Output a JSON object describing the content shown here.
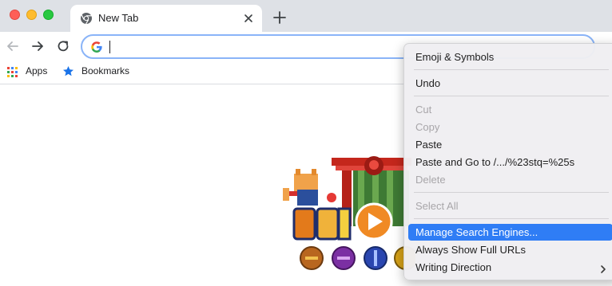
{
  "window": {
    "controls": [
      "close",
      "minimize",
      "zoom"
    ]
  },
  "tab": {
    "title": "New Tab",
    "icon": "chrome-icon"
  },
  "toolbar": {
    "omnibox_value": ""
  },
  "bookmarks": {
    "apps_label": "Apps",
    "bookmarks_label": "Bookmarks"
  },
  "menu": {
    "items": [
      {
        "label": "Emoji & Symbols",
        "enabled": true
      },
      {
        "label": "Undo",
        "enabled": true
      },
      {
        "label": "Cut",
        "enabled": false
      },
      {
        "label": "Copy",
        "enabled": false
      },
      {
        "label": "Paste",
        "enabled": true
      },
      {
        "label": "Paste and Go to /.../%23stq=%25s",
        "enabled": true
      },
      {
        "label": "Delete",
        "enabled": false
      },
      {
        "label": "Select All",
        "enabled": false
      },
      {
        "label": "Manage Search Engines...",
        "enabled": true,
        "highlighted": true
      },
      {
        "label": "Always Show Full URLs",
        "enabled": true
      },
      {
        "label": "Writing Direction",
        "enabled": true,
        "submenu": true
      }
    ]
  },
  "colors": {
    "accent": "#2f7df5",
    "titlebar": "#dee1e6",
    "omnibox_focus": "#8ab4f8"
  }
}
